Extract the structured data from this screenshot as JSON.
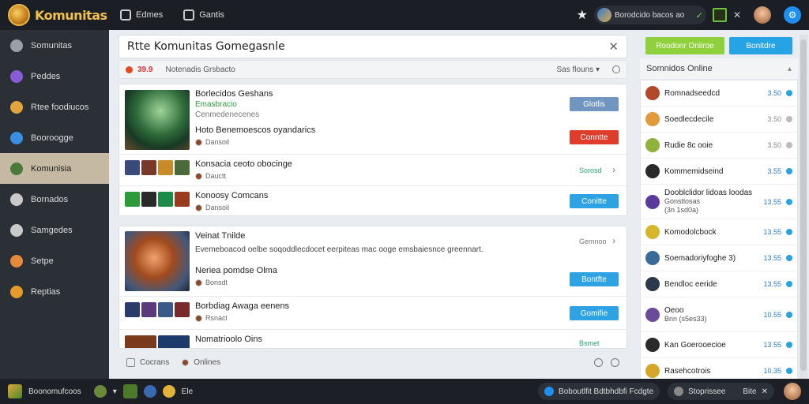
{
  "app": {
    "logo_text": "Komunitas"
  },
  "topbar": {
    "nav": [
      {
        "label": "Edmes",
        "icon": "chat-icon"
      },
      {
        "label": "Gantis",
        "icon": "grid-icon"
      }
    ],
    "search_text": "Borodcido bacos ao",
    "icons": [
      "star-icon",
      "check-icon",
      "green-square-icon",
      "close-icon",
      "user-avatar",
      "settings-icon"
    ]
  },
  "sidebar": {
    "items": [
      {
        "label": "Somunitas",
        "icon": "home-icon",
        "color": "#9aa0a8"
      },
      {
        "label": "Peddes",
        "icon": "character-icon",
        "color": "#8b5bd6"
      },
      {
        "label": "Rtee foodiucos",
        "icon": "globe-icon",
        "color": "#e3a43b"
      },
      {
        "label": "Booroogge",
        "icon": "planet-icon",
        "color": "#3a8ee6"
      },
      {
        "label": "Komunisia",
        "icon": "community-icon",
        "color": "#4a7a3a",
        "active": true
      },
      {
        "label": "Bornados",
        "icon": "compass-icon",
        "color": "#c9c9c9"
      },
      {
        "label": "Samgedes",
        "icon": "box-icon",
        "color": "#c9c9c9"
      },
      {
        "label": "Setpe",
        "icon": "map-icon",
        "color": "#e58a3a"
      },
      {
        "label": "Reptias",
        "icon": "sun-icon",
        "color": "#e59a2a"
      }
    ]
  },
  "main": {
    "title": "Rtte Komunitas Gomegasnle",
    "filter": {
      "count": "39.9",
      "label": "Notenadis Grsbacto",
      "sort": "Sas flouns"
    },
    "rows": [
      {
        "title": "Borlecidos Geshans",
        "sub": "Emasbracio",
        "desc": "Cenmedenecenes",
        "button": "Glotlis",
        "button_style": "gray"
      },
      {
        "title": "Hoto Benemoescos oyandarics",
        "meta": "Dansoil",
        "button": "Conntte",
        "button_style": "red"
      },
      {
        "title": "Konsacia ceoto obocinge",
        "meta": "Dauctt",
        "status": "Sorosd"
      },
      {
        "title": "Konoosy Comcans",
        "meta": "Dansoil",
        "button": "Conitte",
        "button_style": "blue"
      },
      {
        "title": "Veinat Tnilde",
        "desc": "Evemeboacod oelbe soqoddlecdocet eerpiteas mac ooge emsbaiesnce greennart.",
        "status": "Gemnoo"
      },
      {
        "title": "Neriea pomdse Olma",
        "meta": "Bonsdt",
        "button": "Bontfte",
        "button_style": "blue"
      },
      {
        "title": "Borbdiag Awaga eenens",
        "meta": "Rsnacl",
        "button": "Gomifie",
        "button_style": "blue"
      },
      {
        "title": "Nomatrioolo Oins",
        "status": "Bsmet"
      }
    ],
    "footer": {
      "left": "Cocrans",
      "right": "Onlines"
    }
  },
  "right_panel": {
    "btn_green": "Roodonr Oniiroe",
    "btn_blue": "Bonitdre",
    "online_title": "Somnidos Online",
    "users": [
      {
        "name": "Romnadseedcd",
        "num": "3.50",
        "color": "#b24a2a"
      },
      {
        "name": "Soedlecdecile",
        "num": "3.50",
        "color": "#e39a3a"
      },
      {
        "name": "Rudie 8c ooie",
        "num": "3.50",
        "color": "#8fb23a"
      },
      {
        "name": "Kommemidseind",
        "num": "3.55",
        "color": "#2a2a2a"
      },
      {
        "name": "Dooblclidor lidoas loodas",
        "sub": "Gonstlosas",
        "sub2": "(3n 1sd0a)",
        "num": "13.55",
        "color": "#5a3a9a",
        "tall": true
      },
      {
        "name": "Komodolcbock",
        "num": "13.55",
        "color": "#d6b62a"
      },
      {
        "name": "Soemadoriyfoghe 3)",
        "num": "13.55",
        "color": "#3a6a9a"
      },
      {
        "name": "Bendloc eeride",
        "num": "13.55",
        "color": "#2a3a4a"
      },
      {
        "name": "Oeoo",
        "sub": "Bnn (s5es33)",
        "num": "10.55",
        "color": "#6a4a9a",
        "tall": true
      },
      {
        "name": "Kan Goerooecioe",
        "num": "13.55",
        "color": "#2a2a2a"
      },
      {
        "name": "Rasehcotrois",
        "num": "10.35",
        "color": "#d6a62a"
      }
    ]
  },
  "taskbar": {
    "app_label": "Boonomufcoos",
    "badge_text": "Ele",
    "pill_text": "Boboutlfit Bdtbhdbfi Fcdgte",
    "pill2_text": "Stoprissee",
    "pill2_badge": "Bite"
  }
}
